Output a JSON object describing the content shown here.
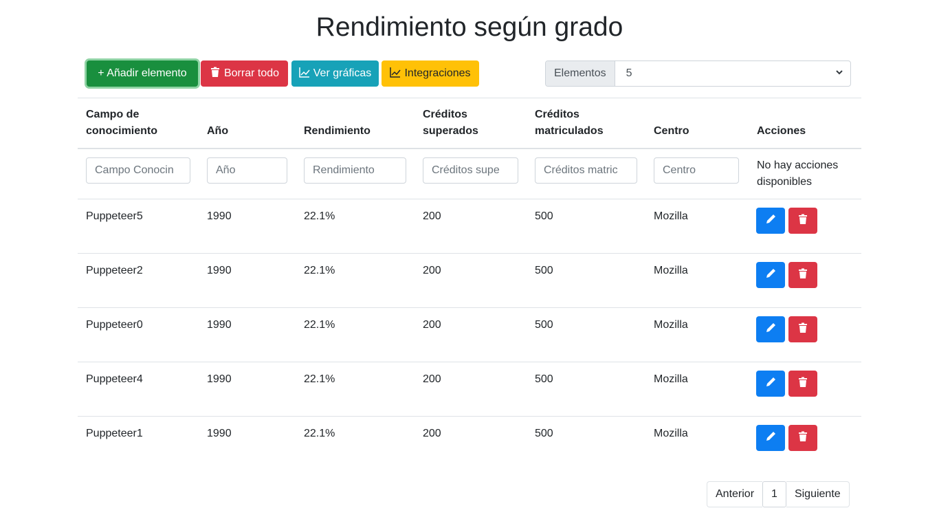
{
  "page": {
    "title": "Rendimiento según grado"
  },
  "toolbar": {
    "add_label": "+ Añadir elemento",
    "delete_all_label": "Borrar todo",
    "charts_label": "Ver gráficas",
    "integrations_label": "Integraciones"
  },
  "page_size": {
    "label": "Elementos",
    "value": "5"
  },
  "table": {
    "headers": {
      "campo": "Campo de conocimiento",
      "anio": "Año",
      "rendimiento": "Rendimiento",
      "superados": "Créditos superados",
      "matriculados": "Créditos matriculados",
      "centro": "Centro",
      "acciones": "Acciones"
    },
    "filters": {
      "campo": "Campo Conocin",
      "anio": "Año",
      "rendimiento": "Rendimiento",
      "superados": "Créditos supe",
      "matriculados": "Créditos matric",
      "centro": "Centro"
    },
    "no_actions": "No hay acciones disponibles",
    "rows": [
      {
        "campo": "Puppeteer5",
        "anio": "1990",
        "rendimiento": "22.1%",
        "superados": "200",
        "matriculados": "500",
        "centro": "Mozilla"
      },
      {
        "campo": "Puppeteer2",
        "anio": "1990",
        "rendimiento": "22.1%",
        "superados": "200",
        "matriculados": "500",
        "centro": "Mozilla"
      },
      {
        "campo": "Puppeteer0",
        "anio": "1990",
        "rendimiento": "22.1%",
        "superados": "200",
        "matriculados": "500",
        "centro": "Mozilla"
      },
      {
        "campo": "Puppeteer4",
        "anio": "1990",
        "rendimiento": "22.1%",
        "superados": "200",
        "matriculados": "500",
        "centro": "Mozilla"
      },
      {
        "campo": "Puppeteer1",
        "anio": "1990",
        "rendimiento": "22.1%",
        "superados": "200",
        "matriculados": "500",
        "centro": "Mozilla"
      }
    ]
  },
  "pagination": {
    "prev": "Anterior",
    "current": "1",
    "next": "Siguiente"
  },
  "icons": {
    "add": "plus",
    "delete_all": "trash-icon",
    "charts": "chart-line-icon",
    "integrations": "chart-line-icon",
    "edit": "pencil-icon",
    "delete": "trash-icon",
    "select": "chevron-down-icon"
  },
  "colors": {
    "success": "#198f3e",
    "danger": "#dc3545",
    "info": "#17a2b8",
    "warning": "#ffc107",
    "primary": "#0d7ef2"
  }
}
